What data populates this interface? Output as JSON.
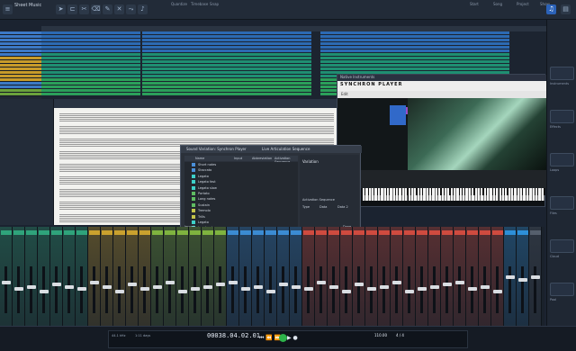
{
  "app": {
    "title": "Studio One",
    "song_title": "Sheet Music"
  },
  "topbar": {
    "labels": [
      "Quantize",
      "Timebase",
      "Snap",
      "Start",
      "Song",
      "Project",
      "Show"
    ]
  },
  "plugin": {
    "window_title": "Native Instruments",
    "brand": "SYNCHRON PLAYER",
    "tab": "Edit"
  },
  "mapping": {
    "title": "Sound Variation: Synchron Player",
    "tab": "Live Articulation Sequence",
    "columns": [
      "Name",
      "Input",
      "Abbreviation",
      "Activation Sequence"
    ],
    "rows": [
      {
        "name": "Short notes",
        "color": "#4a8fd8"
      },
      {
        "name": "Staccato",
        "color": "#4a8fd8"
      },
      {
        "name": "Legato",
        "color": "#3dd0c8"
      },
      {
        "name": "Legato fast",
        "color": "#3dd0c8"
      },
      {
        "name": "Legato slow",
        "color": "#3dd0c8"
      },
      {
        "name": "Portato",
        "color": "#5fbd62"
      },
      {
        "name": "Long notes",
        "color": "#5fbd62"
      },
      {
        "name": "Sustain",
        "color": "#5fbd62"
      },
      {
        "name": "Tremolo",
        "color": "#c4c44a"
      },
      {
        "name": "Trills",
        "color": "#c4c44a"
      },
      {
        "name": "Legato",
        "color": "#3dd0c8"
      },
      {
        "name": "Legato slow",
        "color": "#3dd0c8"
      },
      {
        "name": "Legato",
        "color": "#3dd0c8"
      }
    ],
    "variation_label": "Variation",
    "activation_label": "Activation Sequence",
    "type_label": "Type",
    "data_label": "Data",
    "data2_label": "Data 2",
    "footer_left": "Import",
    "footer_right": "Done"
  },
  "transport": {
    "time": "00038.04.02.01",
    "tempo": "110.00",
    "signature": "4 / 4",
    "sample_rate": "44.1 kHz",
    "record_max": "1:11 days"
  },
  "browser": {
    "items": [
      "Instruments",
      "Effects",
      "Loops",
      "Files",
      "Cloud",
      "Pool"
    ]
  },
  "mixer": {
    "strip_colors": [
      "#2fa37b",
      "#2fa37b",
      "#2fa37b",
      "#2fa37b",
      "#2fa37b",
      "#2fa37b",
      "#2fa37b",
      "#caa12e",
      "#caa12e",
      "#caa12e",
      "#caa12e",
      "#caa12e",
      "#7fb33f",
      "#7fb33f",
      "#7fb33f",
      "#7fb33f",
      "#7fb33f",
      "#7fb33f",
      "#3b8bd2",
      "#3b8bd2",
      "#3b8bd2",
      "#3b8bd2",
      "#3b8bd2",
      "#3b8bd2",
      "#cf4b3f",
      "#cf4b3f",
      "#cf4b3f",
      "#cf4b3f",
      "#cf4b3f",
      "#cf4b3f",
      "#cf4b3f",
      "#cf4b3f",
      "#cf4b3f",
      "#cf4b3f",
      "#cf4b3f",
      "#cf4b3f",
      "#cf4b3f",
      "#cf4b3f",
      "#cf4b3f",
      "#cf4b3f",
      "#2d8fd8",
      "#2d8fd8",
      "#555f6d"
    ],
    "fader_levels": [
      0.7,
      0.55,
      0.6,
      0.5,
      0.65,
      0.6,
      0.55,
      0.7,
      0.6,
      0.5,
      0.65,
      0.55,
      0.6,
      0.7,
      0.5,
      0.55,
      0.6,
      0.65,
      0.7,
      0.55,
      0.6,
      0.5,
      0.65,
      0.6,
      0.55,
      0.7,
      0.6,
      0.5,
      0.65,
      0.55,
      0.6,
      0.7,
      0.5,
      0.55,
      0.6,
      0.65,
      0.7,
      0.55,
      0.6,
      0.5,
      0.8,
      0.75,
      0.8
    ]
  }
}
